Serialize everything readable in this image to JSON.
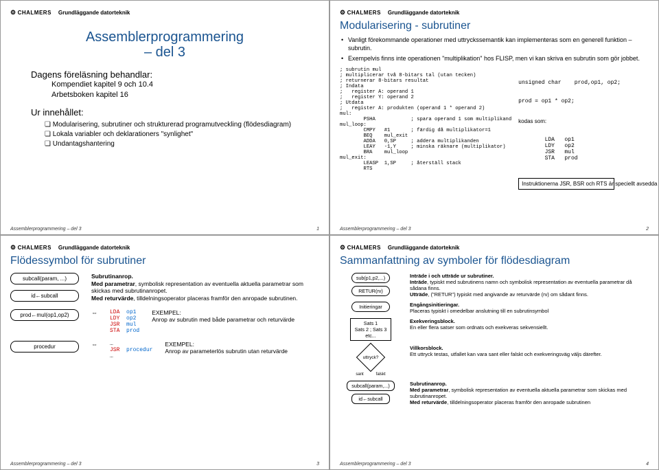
{
  "common": {
    "logo": "CHALMERS",
    "course": "Grundläggande datorteknik",
    "footer": "Assemblerprogrammering – del 3"
  },
  "slide1": {
    "title_l1": "Assemblerprogrammering",
    "title_l2": "– del 3",
    "lecture": "Dagens föreläsning behandlar:",
    "comp_l1": "Kompendiet kapitel 9 och 10.4",
    "comp_l2": "Arbetsboken kapitel 16",
    "subhead": "Ur innehållet:",
    "items": [
      "Modularisering, subrutiner och strukturerad programutveckling (flödesdiagram)",
      "Lokala variabler och deklarationers \"synlighet\"",
      "Undantagshantering"
    ],
    "page": "1"
  },
  "slide2": {
    "title": "Modularisering - subrutiner",
    "b1": "Vanligt förekommande operationer med uttryckssemantik kan implementeras som en generell funktion – subrutin.",
    "b2": "Exempelvis finns inte operationen \"multiplikation\" hos FLISP, men vi kan skriva en subrutin som gör jobbet.",
    "code": "; subrutin mul\n; multiplicerar två 8-bitars tal (utan tecken)\n; returnerar 8-bitars resultat\n; Indata\n;   register A: operand 1\n;   register Y: operand 2\n; Utdata\n;   register A: produkten (operand 1 * operand 2)\nmul:\n        PSHA            ; spara operand 1 som multiplikand\nmul_loop:\n        CMPY   #1       ; färdig då multiplikator=1\n        BEQ    mul_exit\n        ADDA   0,SP     ; addera multiplikanden\n        LEAY   -1,Y     ; minska räknare (multiplikator)\n        BRA    mul_loop\nmul_exit:\n        LEASP  1,SP     ; återställ stack\n        RTS",
    "c_sig": "unsigned char    prod,op1, op2;",
    "c_expr": "prod = op1 * op2;",
    "c_kod": "kodas som:",
    "c_asm": "        LDA   op1\n        LDY   op2\n        JSR   mul\n        STA   prod",
    "note": "Instruktionerna JSR, BSR och RTS är speciellt avsedda för detta.",
    "page": "2"
  },
  "slide3": {
    "title": "Flödessymbol för subrutiner",
    "sym1": "subcall(param, ...)",
    "sym2": "id←subcall",
    "desc1_head": "Subrutinanrop.",
    "desc1_b": "Med parametrar, symbolisk representation av eventuella aktuella parametrar som skickas med subrutinanropet.",
    "desc1_c": "Med returvärde, tilldelningsoperator placeras framför den anropade subrutinen.",
    "sym3": "prod←mul(op1,op2)",
    "code3": "…\nLDA  op1\nLDY  op2\nJSR  mul\nSTA  prod\n…",
    "ex3h": "EXEMPEL:",
    "ex3": "Anrop av subrutin med både parametrar och returvärde",
    "sym4": "procedur",
    "code4": "…\nJSR  procedur\n…",
    "ex4h": "EXEMPEL:",
    "ex4": "Anrop av parameterlös subrutin utan returvärde",
    "page": "3"
  },
  "slide4": {
    "title": "Sammanfattning av symboler för flödesdiagram",
    "r1s1": "sub(p1,p2,...)",
    "r1s2": "RETUR(rv)",
    "r1h": "Inträde i och utträde ur subrutiner.",
    "r1a": "Inträde, typiskt med subrutinens namn och symbolisk representation av eventuella parametrar då sådana finns.",
    "r1b": "Utträde, (\"RETUR\") typiskt med angivande av returvärde (rv) om sådant finns.",
    "r2s": "Initieringar",
    "r2h": "Engångsinitieringar.",
    "r2a": "Placeras typiskt i omedelbar anslutning till en subrutinsymbol",
    "r3s": "Sats 1\nSats 2 ; Sats 3\netc...",
    "r3h": "Exekveringsblock.",
    "r3a": "En eller flera satser som ordnats och exekveras sekvensiellt.",
    "r4s": "uttryck?",
    "r4l1": "sant",
    "r4l2": "falskt",
    "r4h": "Villkorsblock.",
    "r4a": "Ett uttryck testas, utfallet kan vara sant eller falskt och exekveringsväg väljs därefter.",
    "r5s1": "subcall(param,...)",
    "r5s2": "id←subcall",
    "r5h": "Subrutinanrop.",
    "r5a": "Med parametrar, symbolisk representation av eventuella aktuella parametrar som skickas med subrutinanropet.",
    "r5b": "Med returvärde, tilldelningsoperator placeras framför den anropade subrutinen",
    "page": "4"
  }
}
